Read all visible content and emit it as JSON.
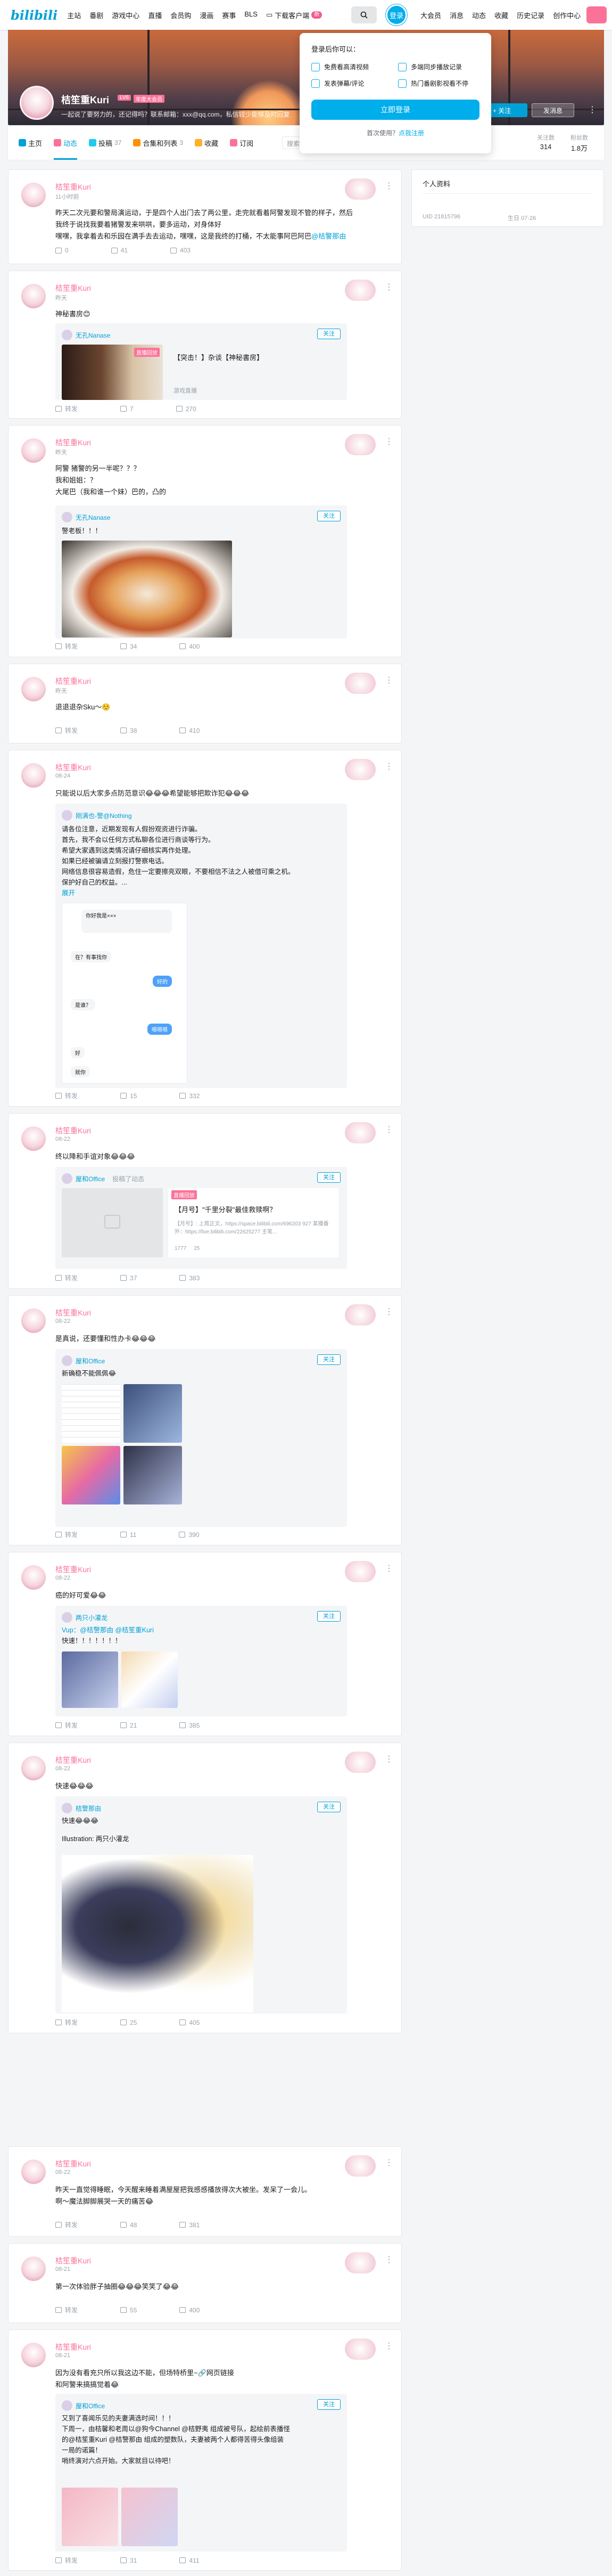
{
  "nav": {
    "logo": "bilibili",
    "items": [
      "主站",
      "番剧",
      "游戏中心",
      "直播",
      "会员购",
      "漫画",
      "赛事",
      "BLS"
    ],
    "download": "下载客户端",
    "download_badge": "新",
    "login": "登录",
    "right_items": [
      "大会员",
      "消息",
      "动态",
      "收藏",
      "历史记录",
      "创作中心"
    ]
  },
  "popover": {
    "title": "登录后你可以：",
    "features": [
      "免费看高清视频",
      "多端同步播放记录",
      "发表弹幕/评论",
      "热门番剧影视看不停"
    ],
    "login_button": "立即登录",
    "register_prompt": "首次使用？",
    "register_link": "点我注册"
  },
  "profile": {
    "name": "桔笙重Kuri",
    "level": "LV6",
    "vip": "年度大会员",
    "sign": "一起说了要努力的，还记得吗？联系邮箱：xxx@qq.com，私信较少能够及时回复",
    "follow": "+ 关注",
    "message": "发消息",
    "more": "⋮"
  },
  "tabs": [
    {
      "label": "主页",
      "count": "",
      "color": "#00a1d6"
    },
    {
      "label": "动态",
      "count": "",
      "color": "#fb7299",
      "active": true
    },
    {
      "label": "投稿",
      "count": "37",
      "color": "#23c9ed"
    },
    {
      "label": "合集和列表",
      "count": "3",
      "color": "#ff9100"
    },
    {
      "label": "收藏",
      "count": "",
      "color": "#ffb027"
    },
    {
      "label": "订阅",
      "count": "",
      "color": "#fb7299"
    }
  ],
  "search_placeholder": "搜索视频、动态",
  "stats": [
    {
      "label": "关注数",
      "value": "314"
    },
    {
      "label": "粉丝数",
      "value": "1.8万"
    }
  ],
  "sidebar": {
    "title": "个人资料",
    "uid": "UID 21815796",
    "birthday": "生日 07-26"
  },
  "posts": [
    {
      "name": "桔笙重Kuri",
      "time": "11小时前",
      "text": "昨天二次元要和警局演运动，于是四个人出门去了两公里，走完就看着阿警发现不管的样子，然后我终于说找我要着猪警发来哄哄，要多运动，对身体好",
      "text2": "嘿嘿，我拿着去和乐园在满手去去运动，嘿嘿，这是我终的打桶，不太能事阿巴阿巴",
      "mention": "@桔警那由",
      "actions": [
        "",
        "",
        "403"
      ],
      "act_counts": {
        "forward": "0",
        "comment": "41",
        "like": "403"
      }
    },
    {
      "name": "桔笙重Kuri",
      "time": "昨天",
      "text": "神秘書房😊",
      "repost_user": "无孔Nanase",
      "video_title": "【突击！】杂谈【神秘書房】",
      "video_sub": "游戏直播",
      "video_badge": "直播回放",
      "actions": {
        "forward": "转发",
        "comment": "7",
        "like": "270"
      }
    },
    {
      "name": "桔笙重Kuri",
      "time": "昨天",
      "text": "阿警 猪警的另一半呢？？？",
      "text2": "我和姐姐：？",
      "text3": "大尾巴（我和谁一个妹）巴的，凸的",
      "repost_user": "无孔Nanase",
      "repost_text": "警老板！！！",
      "actions": {
        "forward": "转发",
        "comment": "34",
        "like": "400"
      }
    },
    {
      "name": "桔笙重Kuri",
      "time": "昨天",
      "text": "退退退杂Sku～☺️",
      "actions": {
        "forward": "转发",
        "comment": "38",
        "like": "410"
      }
    },
    {
      "name": "桔笙重Kuri",
      "time": "08-24",
      "text": "只能说以后大家多点防范意识😂😂😂希望能够把欺诈犯😂😂😂",
      "repost_user": "刚满也-警@Nothing",
      "repost_lines": [
        "请各位注意，近期发现有人假扮观资进行诈骗。",
        "首先，我不会以任何方式私聊各位进行商谈等行为。",
        "希望大家遇到这类情况请仔细核实再作处理。",
        "如果已经被骗请立刻报打警察电话。",
        "网络信息很容易造假，危住一定要擦亮双眼，不要相信不法之人被借可乘之机。",
        "保护好自己的权益。..."
      ],
      "expand": "展开",
      "chat_lines": [
        "你好我是×××",
        "在？有事找你",
        "好的",
        "是谁？",
        "嗯嗯嗯",
        "好",
        "就你"
      ],
      "actions": {
        "forward": "转发",
        "comment": "15",
        "like": "332"
      }
    },
    {
      "name": "桔笙重Kuri",
      "time": "08-22",
      "text": "终以降和手谊对象😂😂😂",
      "repost_user": "屋和Office",
      "repost_tag": "投稿了动态",
      "article_title": "【月号】\"千里分裂\"最佳救赎啊？",
      "article_desc": "【月号】: 上周正文，https://space.bilibili.com/696203 927 某播番外：https://live.bilibili.com/22625277 主笔...",
      "article_badge": "直播回放",
      "article_stats": [
        "1777",
        "25"
      ],
      "actions": {
        "forward": "转发",
        "comment": "37",
        "like": "383"
      }
    },
    {
      "name": "桔笙重Kuri",
      "time": "08-22",
      "text": "是真说，还要懂和性办卡😂😂😂",
      "repost_user": "屋和Office",
      "repost_text": "新确稳不能佩佩😂",
      "actions": {
        "forward": "转发",
        "comment": "11",
        "like": "390"
      }
    },
    {
      "name": "桔笙重Kuri",
      "time": "08-22",
      "text": "癌的好可爱😂😂",
      "repost_user": "两只小灌龙",
      "repost_text": "Vup：@桔警那由 @桔笙重Kuri",
      "repost_text2": "快速！！！！！！！",
      "actions": {
        "forward": "转发",
        "comment": "21",
        "like": "385"
      }
    },
    {
      "name": "桔笙重Kuri",
      "time": "08-22",
      "text": "快速😂😂😂",
      "repost_user": "桔警那由",
      "repost_text": "快速😂😂😂",
      "repost_text2": "Illustration: 两只小灌龙",
      "actions": {
        "forward": "转发",
        "comment": "25",
        "like": "405"
      }
    },
    {
      "name": "桔笙重Kuri",
      "time": "08-22",
      "text": "昨天一直觉得睡眠，今天醒来睡着满屋屋把我感感播放得次大被坐。发呆了一会儿。",
      "text2": "啊～魔法脚脚展哭一天的痛苦😂",
      "actions": {
        "forward": "转发",
        "comment": "48",
        "like": "381"
      }
    },
    {
      "name": "桔笙重Kuri",
      "time": "08-21",
      "text": "第一次体验胖子抽圈😂😂😂笑笑了😂😂",
      "actions": {
        "forward": "转发",
        "comment": "55",
        "like": "400"
      }
    },
    {
      "name": "桔笙重Kuri",
      "time": "08-21",
      "text": "因为没有看充只所以我这边不能，但场特桥里~🔗网页链接",
      "text2": "和阿警来搞搞觉着😂",
      "repost_user": "屋和Office",
      "repost_lines": [
        "又到了喜闻乐见的夫妻满选时间！！！",
        "下周一，由桔馨和老周以@狗今Channel @桔野夷 组成被号队，起绘前表播怪",
        "的@桔笙重Kuri @桔警那由 组成的塑数队，夫妻被两个人都得苦得头像组装",
        "一局的诺篇！",
        "哨终演对六点开始。大家就目以待吧！"
      ],
      "actions": {
        "forward": "转发",
        "comment": "31",
        "like": "411"
      }
    }
  ]
}
